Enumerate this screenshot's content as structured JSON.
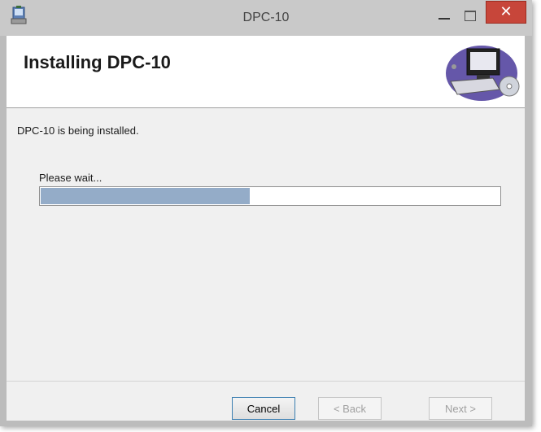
{
  "window": {
    "title": "DPC-10",
    "close_glyph": "✕"
  },
  "banner": {
    "heading": "Installing DPC-10",
    "art_icon": "computer-setup-icon"
  },
  "body": {
    "status": "DPC-10 is being installed.",
    "wait_label": "Please wait...",
    "progress_fraction": 0.455
  },
  "buttons": {
    "cancel": "Cancel",
    "back": "< Back",
    "next": "Next >"
  },
  "colors": {
    "progress_fill": "#94acc8",
    "close_button": "#c7463a",
    "title_bar": "#c9c9c9"
  }
}
